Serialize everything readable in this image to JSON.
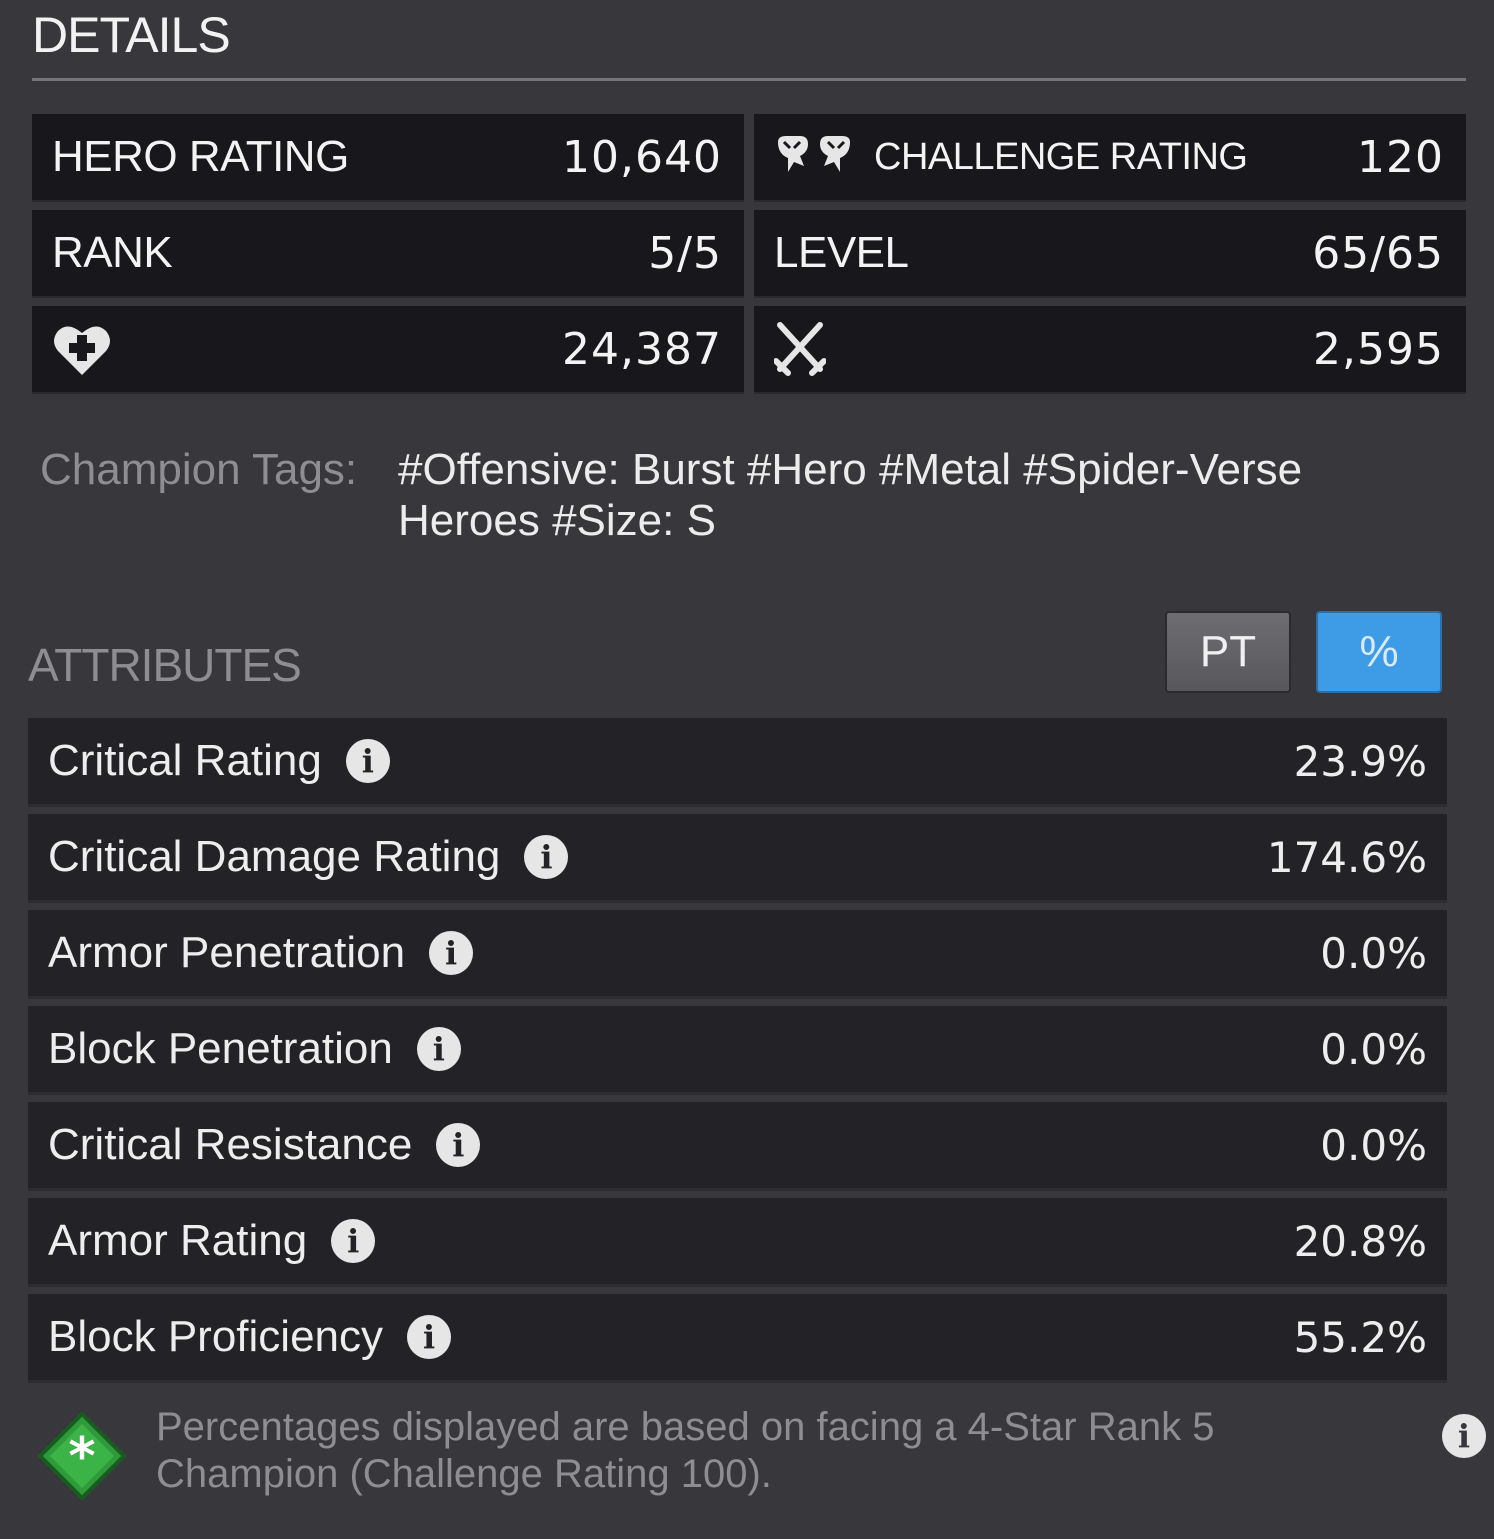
{
  "header": {
    "title": "DETAILS"
  },
  "stats": {
    "hero_rating": {
      "label": "HERO RATING",
      "value": "10,640"
    },
    "challenge_rating": {
      "label": "CHALLENGE RATING",
      "value": "120",
      "icon": "challenge-rating-icon"
    },
    "rank": {
      "label": "RANK",
      "value": "5/5"
    },
    "level": {
      "label": "LEVEL",
      "value": "65/65"
    },
    "health": {
      "icon": "health-heart-icon",
      "value": "24,387"
    },
    "attack": {
      "icon": "crossed-swords-icon",
      "value": "2,595"
    }
  },
  "tags": {
    "label": "Champion Tags:",
    "value": "#Offensive: Burst #Hero #Metal #Spider-Verse Heroes #Size: S"
  },
  "attributes": {
    "title": "ATTRIBUTES",
    "toggle_pt": "PT",
    "toggle_pct": "%",
    "active_toggle": "%",
    "rows": [
      {
        "name": "Critical Rating",
        "value": "23.9%"
      },
      {
        "name": "Critical Damage Rating",
        "value": "174.6%"
      },
      {
        "name": "Armor Penetration",
        "value": "0.0%"
      },
      {
        "name": "Block Penetration",
        "value": "0.0%"
      },
      {
        "name": "Critical Resistance",
        "value": "0.0%"
      },
      {
        "name": "Armor Rating",
        "value": "20.8%"
      },
      {
        "name": "Block Proficiency",
        "value": "55.2%"
      }
    ],
    "info_glyph": "i"
  },
  "footnote": {
    "text": "Percentages displayed are based on facing a 4-Star Rank 5 Champion (Challenge Rating 100).",
    "icon": "green-asterisk-diamond-icon"
  },
  "colors": {
    "background": "#38373b",
    "panel": "#18171b",
    "row": "#232226",
    "accent": "#3e9be6",
    "muted_text": "#8e8d91"
  }
}
